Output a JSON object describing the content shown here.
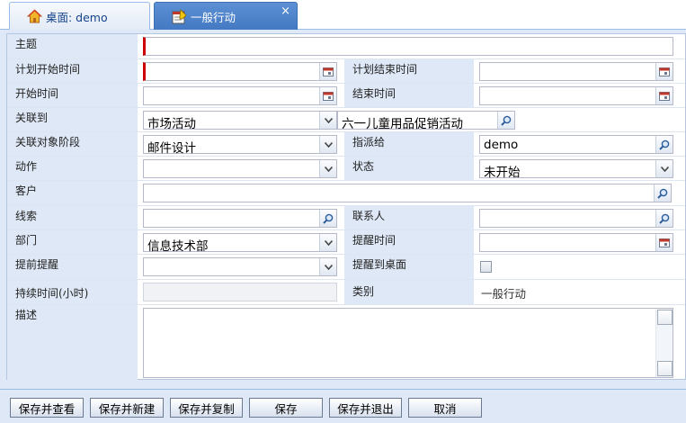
{
  "tabs": [
    {
      "label": "桌面: demo",
      "icon": "home-icon"
    },
    {
      "label": "一般行动",
      "icon": "calendar-edit-icon",
      "close": "×"
    }
  ],
  "form": {
    "subject_label": "主题",
    "subject_value": "",
    "plan_start_label": "计划开始时间",
    "plan_start_value": "",
    "plan_end_label": "计划结束时间",
    "plan_end_value": "",
    "start_label": "开始时间",
    "start_value": "",
    "end_label": "结束时间",
    "end_value": "",
    "related_label": "关联到",
    "related_type_value": "市场活动",
    "related_object_value": "六一儿童用品促销活动",
    "stage_label": "关联对象阶段",
    "stage_value": "邮件设计",
    "assign_label": "指派给",
    "assign_value": "demo",
    "action_label": "动作",
    "action_value": "",
    "status_label": "状态",
    "status_value": "未开始",
    "customer_label": "客户",
    "customer_value": "",
    "lead_label": "线索",
    "lead_value": "",
    "contact_label": "联系人",
    "contact_value": "",
    "department_label": "部门",
    "department_value": "信息技术部",
    "remind_time_label": "提醒时间",
    "remind_time_value": "",
    "advance_label": "提前提醒",
    "advance_value": "",
    "remind_desktop_label": "提醒到桌面",
    "duration_label": "持续时间(小时)",
    "category_label": "类别",
    "category_value": "一般行动",
    "description_label": "描述",
    "description_value": ""
  },
  "buttons": {
    "save_view": "保存并查看",
    "save_new": "保存并新建",
    "save_copy": "保存并复制",
    "save": "保存",
    "save_exit": "保存并退出",
    "cancel": "取消"
  },
  "colors": {
    "tab_active": "#4a7ec6",
    "label_bg": "#dfe8f6",
    "required_marker": "#cc0000"
  }
}
